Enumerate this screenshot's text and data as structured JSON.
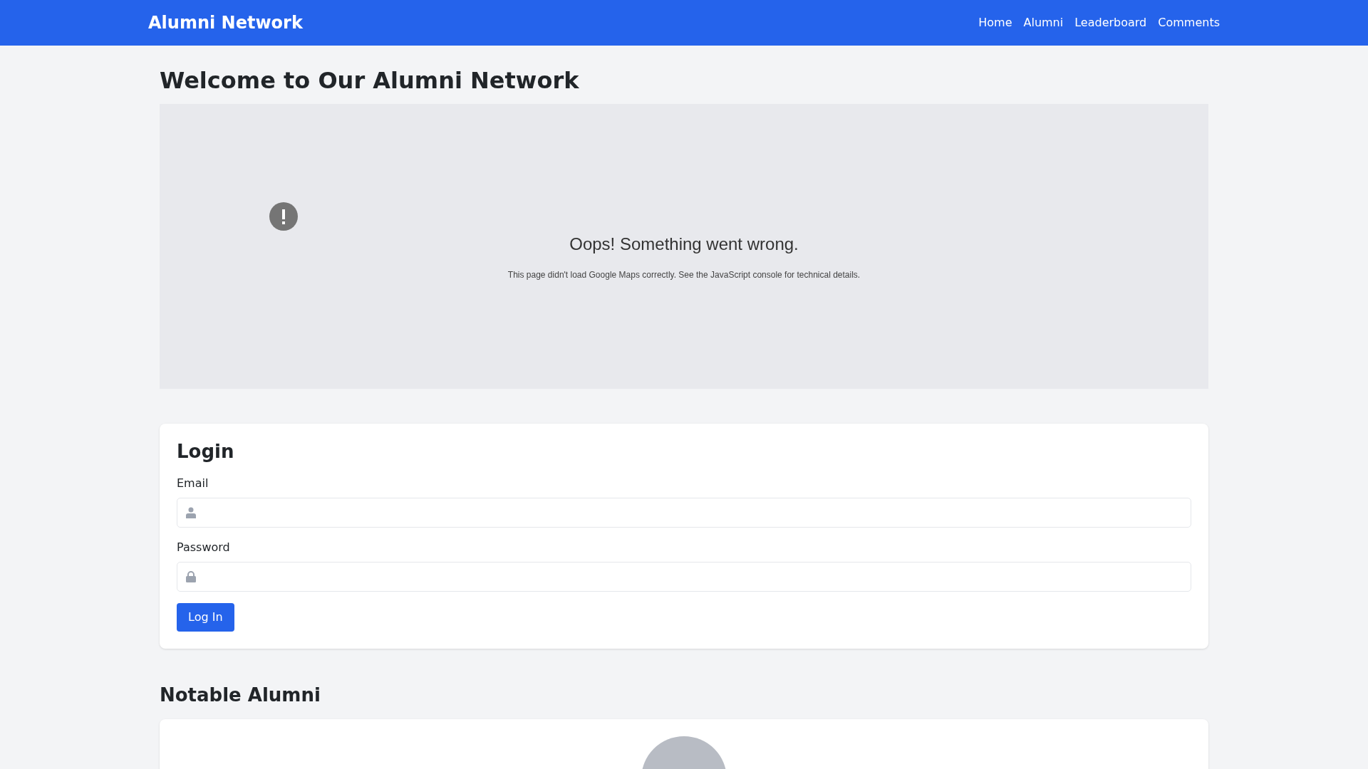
{
  "navbar": {
    "brand": "Alumni Network",
    "links": [
      {
        "label": "Home"
      },
      {
        "label": "Alumni"
      },
      {
        "label": "Leaderboard"
      },
      {
        "label": "Comments"
      }
    ]
  },
  "heading": "Welcome to Our Alumni Network",
  "map_error": {
    "title": "Oops! Something went wrong.",
    "message": "This page didn't load Google Maps correctly. See the JavaScript console for technical details."
  },
  "login": {
    "title": "Login",
    "fields": [
      {
        "label": "Email",
        "kind": "email"
      },
      {
        "label": "Password",
        "kind": "password"
      }
    ],
    "button": "Log In"
  },
  "notable": {
    "title": "Notable Alumni"
  }
}
